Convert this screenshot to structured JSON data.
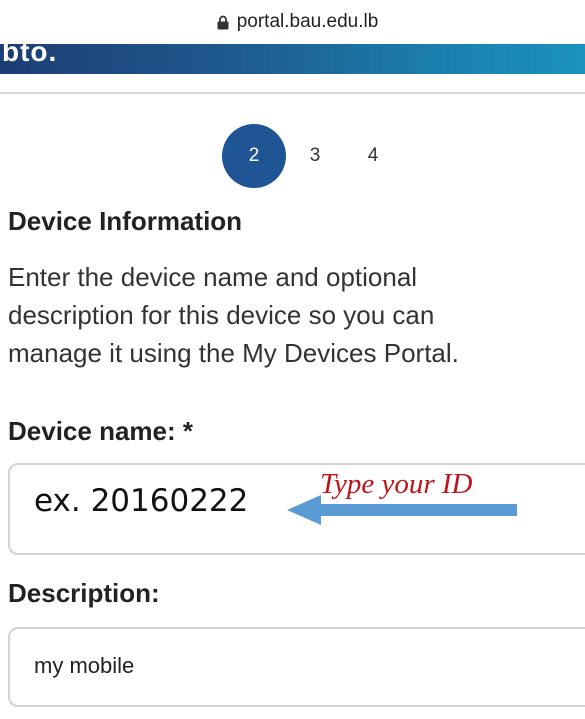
{
  "browser": {
    "url": "portal.bau.edu.lb"
  },
  "banner": {
    "partial_text": "bto."
  },
  "stepper": {
    "steps": [
      "2",
      "3",
      "4"
    ],
    "active": "2"
  },
  "form": {
    "section_title": "Device Information",
    "instructions": [
      "Enter the device name and optional",
      "description for this device so you can",
      "manage it using the My Devices Portal."
    ],
    "device_name_label": "Device name: *",
    "device_name_value": "ex. 20160222",
    "description_label": "Description:",
    "description_value": "my mobile"
  },
  "annotation": {
    "text": "Type your ID",
    "color": "#c0141b",
    "arrow_color": "#5b9bd5"
  },
  "colors": {
    "banner": "#1f5a8f",
    "active_step": "#1f5595"
  }
}
